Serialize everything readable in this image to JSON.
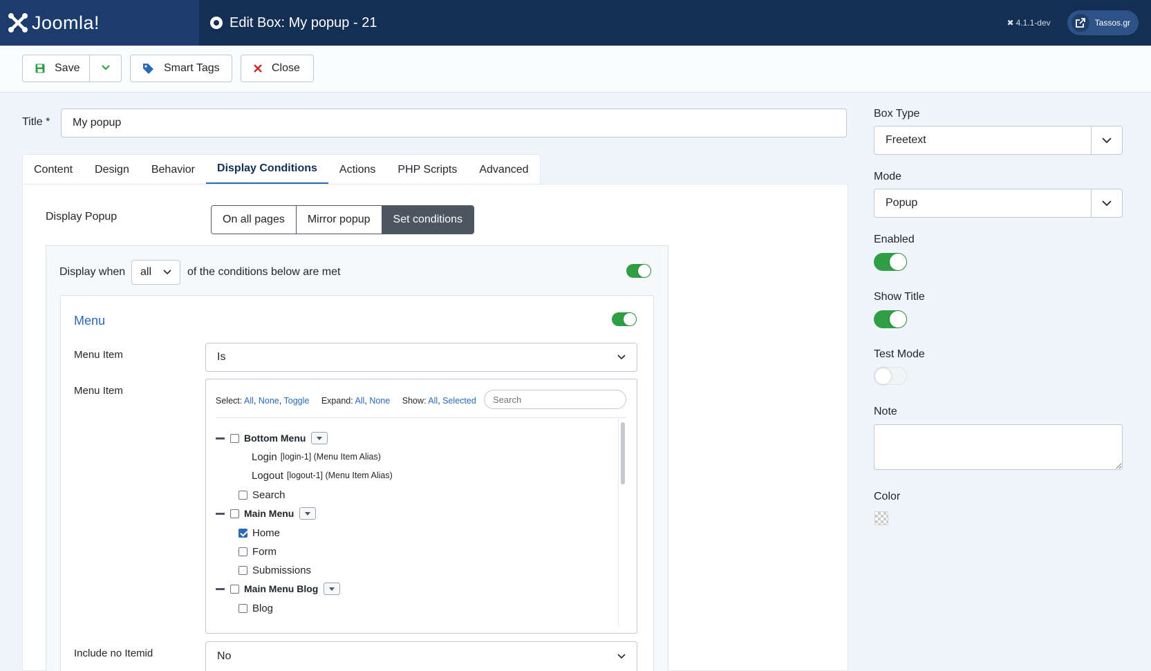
{
  "header": {
    "brand": "Joomla!",
    "page_title": "Edit Box: My popup - 21",
    "version": "4.1.1-dev",
    "site_link": "Tassos.gr"
  },
  "toolbar": {
    "save_label": "Save",
    "smart_tags_label": "Smart Tags",
    "close_label": "Close"
  },
  "form": {
    "title_label": "Title *",
    "title_value": "My popup"
  },
  "tabs": [
    {
      "label": "Content"
    },
    {
      "label": "Design"
    },
    {
      "label": "Behavior"
    },
    {
      "label": "Display Conditions",
      "active": true
    },
    {
      "label": "Actions"
    },
    {
      "label": "PHP Scripts"
    },
    {
      "label": "Advanced"
    }
  ],
  "display_popup": {
    "label": "Display Popup",
    "options": [
      "On all pages",
      "Mirror popup",
      "Set conditions"
    ],
    "selected": "Set conditions"
  },
  "conditions": {
    "display_when_label": "Display when",
    "match_value": "all",
    "tail_text": "of the conditions below are met",
    "enabled": true
  },
  "menu_condition": {
    "title": "Menu",
    "enabled": true,
    "operator_label": "Menu Item",
    "operator_value": "Is",
    "items_label": "Menu Item",
    "tree_toolbar": {
      "select_label": "Select:",
      "select_links": [
        "All",
        "None",
        "Toggle"
      ],
      "expand_label": "Expand:",
      "expand_links": [
        "All",
        "None"
      ],
      "show_label": "Show:",
      "show_links": [
        "All",
        "Selected"
      ],
      "search_placeholder": "Search"
    },
    "tree": [
      {
        "label": "Bottom Menu",
        "type": "group",
        "checked": false
      },
      {
        "label": "Login",
        "alias": "[login-1] (Menu Item Alias)",
        "type": "alias"
      },
      {
        "label": "Logout",
        "alias": "[logout-1] (Menu Item Alias)",
        "type": "alias"
      },
      {
        "label": "Search",
        "type": "item",
        "checked": false
      },
      {
        "label": "Main Menu",
        "type": "group",
        "checked": false
      },
      {
        "label": "Home",
        "type": "item",
        "checked": true
      },
      {
        "label": "Form",
        "type": "item",
        "checked": false
      },
      {
        "label": "Submissions",
        "type": "item",
        "checked": false
      },
      {
        "label": "Main Menu Blog",
        "type": "group",
        "checked": false
      },
      {
        "label": "Blog",
        "type": "item",
        "checked": false
      }
    ],
    "no_itemid_label": "Include no Itemid",
    "no_itemid_value": "No"
  },
  "sidebar": {
    "box_type_label": "Box Type",
    "box_type_value": "Freetext",
    "mode_label": "Mode",
    "mode_value": "Popup",
    "enabled_label": "Enabled",
    "enabled": true,
    "show_title_label": "Show Title",
    "show_title": true,
    "test_mode_label": "Test Mode",
    "test_mode": false,
    "note_label": "Note",
    "note_value": "",
    "color_label": "Color"
  },
  "colors": {
    "header_bg": "#132f53",
    "brand_bg": "#1c3d6b",
    "accent": "#2a69b8",
    "toggle_on": "#2f9e44",
    "close_icon": "#c52827"
  }
}
